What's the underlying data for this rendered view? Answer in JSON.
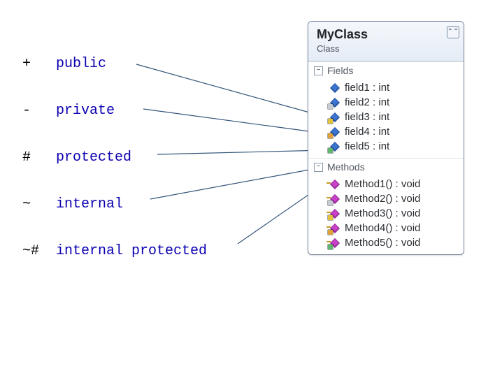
{
  "legend": {
    "items": [
      {
        "symbol": "+",
        "label": "public"
      },
      {
        "symbol": "-",
        "label": "private"
      },
      {
        "symbol": "#",
        "label": "protected"
      },
      {
        "symbol": "~",
        "label": "internal"
      },
      {
        "symbol": "~#",
        "label": "internal protected"
      }
    ]
  },
  "class": {
    "name": "MyClass",
    "stereotype": "Class",
    "sections": {
      "fields": {
        "label": "Fields"
      },
      "methods": {
        "label": "Methods"
      }
    },
    "fields": [
      {
        "name": "field1 : int",
        "access": "public"
      },
      {
        "name": "field2 : int",
        "access": "private"
      },
      {
        "name": "field3 : int",
        "access": "protected"
      },
      {
        "name": "field4 : int",
        "access": "internal"
      },
      {
        "name": "field5 : int",
        "access": "internal protected"
      }
    ],
    "methods": [
      {
        "name": "Method1() : void",
        "access": "public"
      },
      {
        "name": "Method2() : void",
        "access": "private"
      },
      {
        "name": "Method3() : void",
        "access": "protected"
      },
      {
        "name": "Method4() : void",
        "access": "internal"
      },
      {
        "name": "Method5() : void",
        "access": "internal protected"
      }
    ]
  },
  "arrows": [
    {
      "from_legend": 0,
      "to_field": 0
    },
    {
      "from_legend": 1,
      "to_field": 1
    },
    {
      "from_legend": 2,
      "to_field": 2
    },
    {
      "from_legend": 3,
      "to_field": 3
    },
    {
      "from_legend": 4,
      "to_field": 4
    }
  ]
}
